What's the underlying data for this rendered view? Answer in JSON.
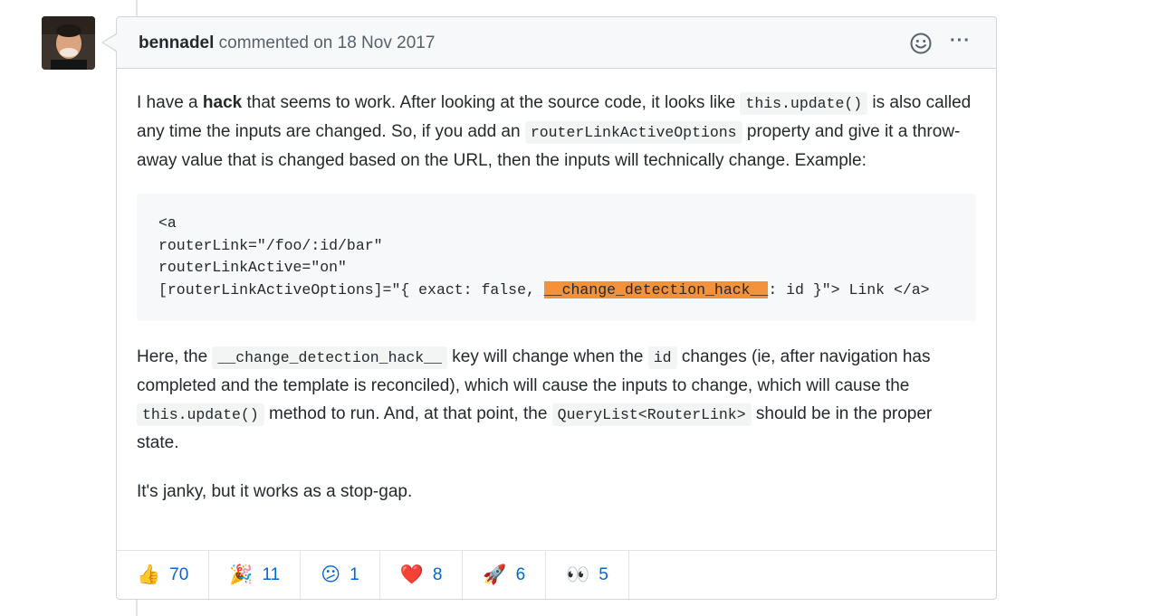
{
  "comment": {
    "author": "bennadel",
    "header_rest": " commented on 18 Nov 2017",
    "more_label": "···"
  },
  "body": {
    "p1_a": "I have a ",
    "p1_bold": "hack",
    "p1_b": " that seems to work. After looking at the source code, it looks like ",
    "p1_code1": "this.update()",
    "p1_c": " is also called any time the inputs are changed. So, if you add an ",
    "p1_code2": "routerLinkActiveOptions",
    "p1_d": " property and give it a throw-away value that is changed based on the URL, then the inputs will technically change. Example:",
    "code_line1": "<a",
    "code_line2": "routerLink=\"/foo/:id/bar\"",
    "code_line3": "routerLinkActive=\"on\"",
    "code_line4_a": "[routerLinkActiveOptions]=\"{ exact: false, ",
    "code_line4_hl": "__change_detection_hack__",
    "code_line4_b": ": id }\"> Link </a>",
    "p2_a": "Here, the ",
    "p2_code1": "__change_detection_hack__",
    "p2_b": " key will change when the ",
    "p2_code2": "id",
    "p2_c": " changes (ie, after navigation has completed and the template is reconciled), which will cause the inputs to change, which will cause the ",
    "p2_code3": "this.update()",
    "p2_d": " method to run. And, at that point, the ",
    "p2_code4": "QueryList<RouterLink>",
    "p2_e": " should be in the proper state.",
    "p3": "It's janky, but it works as a stop-gap."
  },
  "reactions": [
    {
      "emoji": "👍",
      "icon": "thumbs-up-icon",
      "count": "70"
    },
    {
      "emoji": "🎉",
      "icon": "tada-icon",
      "count": "11"
    },
    {
      "emoji": "😕",
      "icon": "confused-icon",
      "count": "1"
    },
    {
      "emoji": "❤️",
      "icon": "heart-icon",
      "count": "8"
    },
    {
      "emoji": "🚀",
      "icon": "rocket-icon",
      "count": "6"
    },
    {
      "emoji": "👀",
      "icon": "eyes-icon",
      "count": "5"
    }
  ],
  "colors": {
    "link": "#0366d6",
    "highlight_orange": "#f4923b",
    "highlight_yellow": "#ffff3a",
    "border": "#d1d5da",
    "header_bg": "#f6f8fa"
  }
}
